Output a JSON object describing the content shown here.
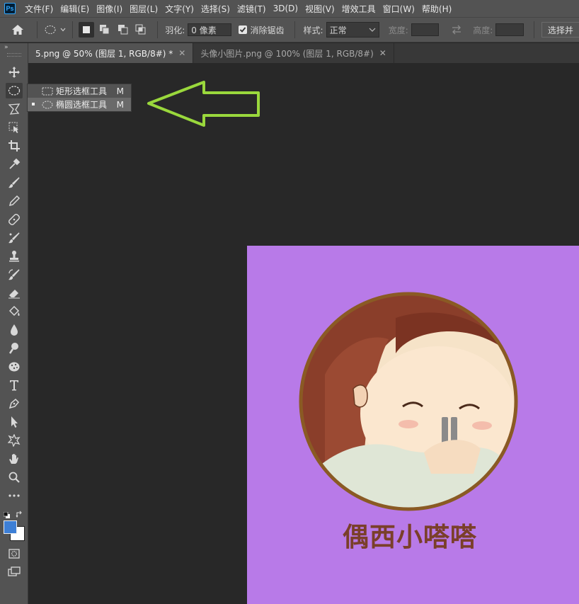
{
  "app": {
    "logo": "Ps"
  },
  "menu": [
    "文件(F)",
    "编辑(E)",
    "图像(I)",
    "图层(L)",
    "文字(Y)",
    "选择(S)",
    "滤镜(T)",
    "3D(D)",
    "视图(V)",
    "增效工具",
    "窗口(W)",
    "帮助(H)"
  ],
  "options": {
    "feather_label": "羽化:",
    "feather_value": "0 像素",
    "antialias_label": "消除锯齿",
    "antialias_checked": true,
    "style_label": "样式:",
    "style_value": "正常",
    "width_label": "宽度:",
    "height_label": "高度:",
    "select_mask_label": "选择并"
  },
  "tabs": [
    {
      "label": "5.png @ 50% (图层 1, RGB/8#) *",
      "active": true
    },
    {
      "label": "头像小图片.png @ 100% (图层 1, RGB/8#)",
      "active": false
    }
  ],
  "flyout": {
    "items": [
      {
        "label": "矩形选框工具",
        "key": "M",
        "selected": false
      },
      {
        "label": "椭圆选框工具",
        "key": "M",
        "selected": true
      }
    ]
  },
  "canvas": {
    "caption": "偶西小嗒嗒",
    "background_color": "#b87ae8",
    "caption_color": "#7a3f2a",
    "border_color": "#8a5a24"
  },
  "colors": {
    "foreground": "#3d7fd6",
    "background": "#ffffff",
    "annotation_arrow": "#9ad83c"
  }
}
